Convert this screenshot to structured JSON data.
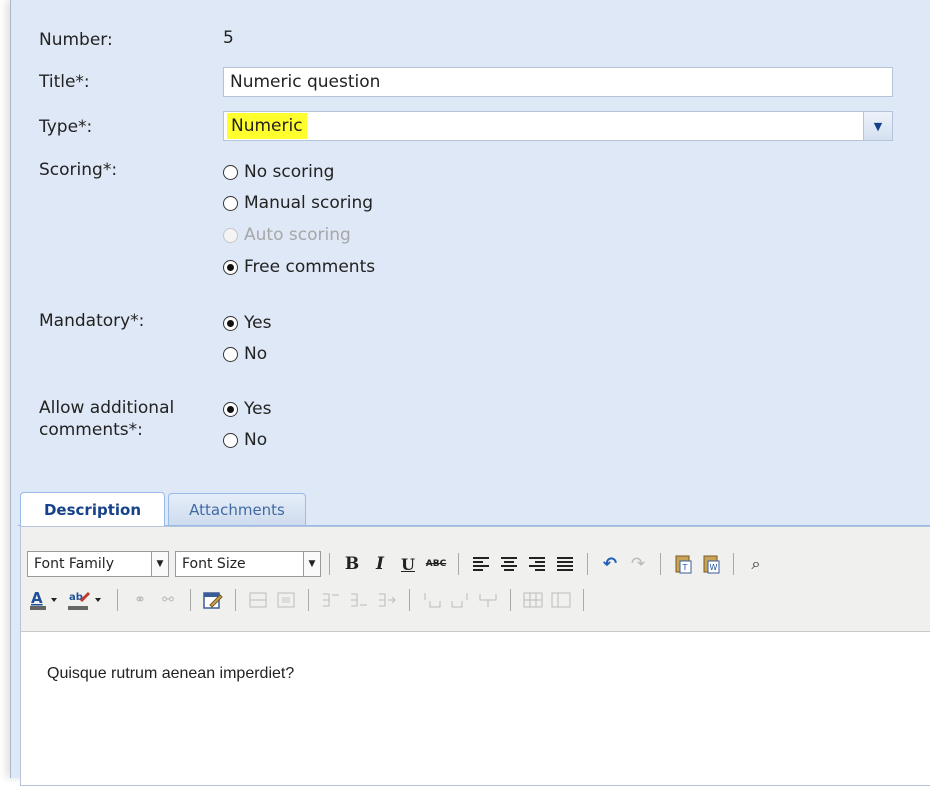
{
  "form": {
    "number_label": "Number:",
    "number_value": "5",
    "title_label": "Title*:",
    "title_value": "Numeric question",
    "type_label": "Type*:",
    "type_value": "Numeric",
    "scoring_label": "Scoring*:",
    "scoring_options": [
      {
        "label": "No scoring",
        "checked": false,
        "disabled": false
      },
      {
        "label": "Manual scoring",
        "checked": false,
        "disabled": false
      },
      {
        "label": "Auto scoring",
        "checked": false,
        "disabled": true
      },
      {
        "label": "Free comments",
        "checked": true,
        "disabled": false
      }
    ],
    "mandatory_label": "Mandatory*:",
    "mandatory_options": [
      {
        "label": "Yes",
        "checked": true
      },
      {
        "label": "No",
        "checked": false
      }
    ],
    "comments_label_line1": "Allow additional",
    "comments_label_line2": "comments*:",
    "comments_options": [
      {
        "label": "Yes",
        "checked": true
      },
      {
        "label": "No",
        "checked": false
      }
    ]
  },
  "tabs": [
    {
      "label": "Description",
      "active": true
    },
    {
      "label": "Attachments",
      "active": false
    }
  ],
  "editor": {
    "font_family": "Font Family",
    "font_size": "Font Size",
    "content": "Quisque rutrum aenean imperdiet?"
  },
  "colors": {
    "panel_bg": "#dfe8f6",
    "highlight": "#ffff2e",
    "tab_text": "#15428b"
  }
}
